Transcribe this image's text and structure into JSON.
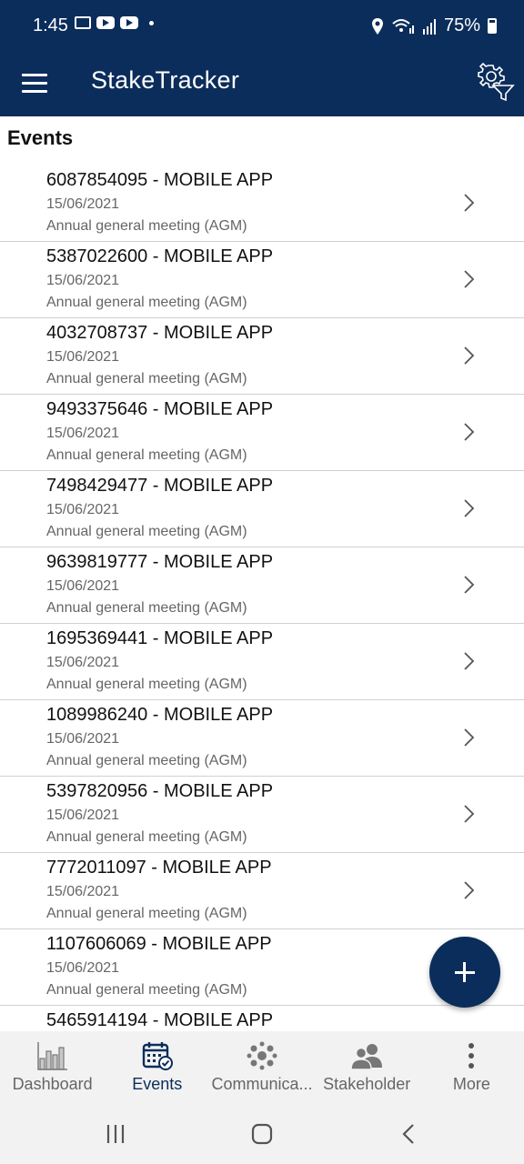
{
  "status_bar": {
    "time": "1:45",
    "battery": "75%"
  },
  "app_bar": {
    "title": "StakeTracker",
    "menu_icon": "hamburger-icon",
    "settings_icon": "settings-filter-icon"
  },
  "section": {
    "title": "Events"
  },
  "events": [
    {
      "title": "6087854095 - MOBILE APP",
      "date": "15/06/2021",
      "type": "Annual general meeting (AGM)"
    },
    {
      "title": "5387022600 - MOBILE APP",
      "date": "15/06/2021",
      "type": "Annual general meeting (AGM)"
    },
    {
      "title": "4032708737 - MOBILE APP",
      "date": "15/06/2021",
      "type": "Annual general meeting (AGM)"
    },
    {
      "title": "9493375646 - MOBILE APP",
      "date": "15/06/2021",
      "type": "Annual general meeting (AGM)"
    },
    {
      "title": "7498429477 - MOBILE APP",
      "date": "15/06/2021",
      "type": "Annual general meeting (AGM)"
    },
    {
      "title": "9639819777 - MOBILE APP",
      "date": "15/06/2021",
      "type": "Annual general meeting (AGM)"
    },
    {
      "title": "1695369441 - MOBILE APP",
      "date": "15/06/2021",
      "type": "Annual general meeting (AGM)"
    },
    {
      "title": "1089986240 - MOBILE APP",
      "date": "15/06/2021",
      "type": "Annual general meeting (AGM)"
    },
    {
      "title": "5397820956 - MOBILE APP",
      "date": "15/06/2021",
      "type": "Annual general meeting (AGM)"
    },
    {
      "title": "7772011097 - MOBILE APP",
      "date": "15/06/2021",
      "type": "Annual general meeting (AGM)"
    },
    {
      "title": "1107606069 - MOBILE APP",
      "date": "15/06/2021",
      "type": "Annual general meeting (AGM)"
    },
    {
      "title": "5465914194 - MOBILE APP",
      "date": "",
      "type": ""
    }
  ],
  "fab": {
    "icon": "plus-icon"
  },
  "bottom_nav": [
    {
      "label": "Dashboard",
      "icon": "bar-chart-icon"
    },
    {
      "label": "Events",
      "icon": "calendar-check-icon"
    },
    {
      "label": "Communica...",
      "icon": "network-icon"
    },
    {
      "label": "Stakeholder",
      "icon": "people-icon"
    },
    {
      "label": "More",
      "icon": "more-vertical-icon"
    }
  ],
  "colors": {
    "primary": "#0b2d5b",
    "nav_background": "#f2f2f2",
    "secondary_text": "#666666"
  }
}
